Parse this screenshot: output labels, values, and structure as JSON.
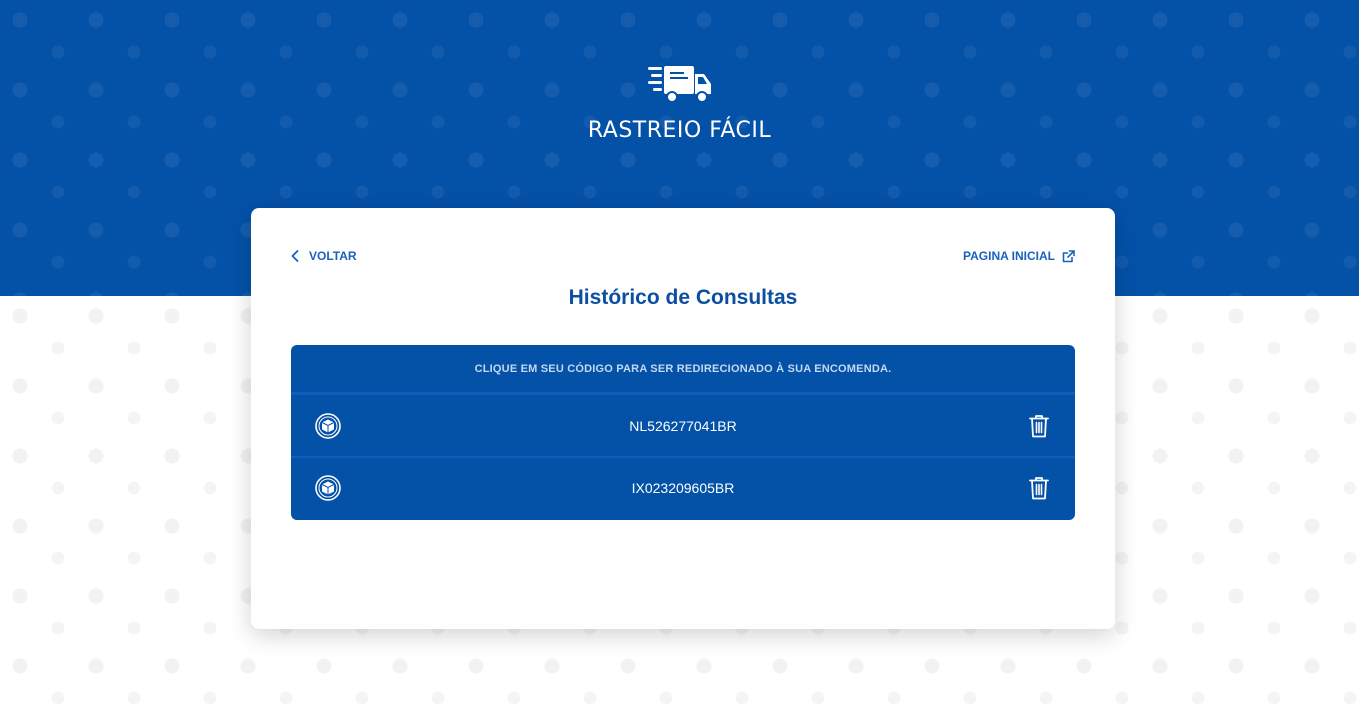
{
  "brand": {
    "name": "RASTREIO FÁCIL",
    "logo_icon": "delivery-truck-icon"
  },
  "nav": {
    "back_label": "VOLTAR",
    "home_label": "PAGINA INICIAL"
  },
  "page": {
    "title": "Histórico de Consultas"
  },
  "history": {
    "instruction": "CLIQUE EM SEU CÓDIGO PARA SER REDIRECIONADO À SUA ENCOMENDA.",
    "items": [
      {
        "code": "NL526277041BR",
        "icon": "package-icon",
        "action_icon": "trash-icon"
      },
      {
        "code": "IX023209605BR",
        "icon": "package-icon",
        "action_icon": "trash-icon"
      }
    ]
  },
  "colors": {
    "primary": "#0451a8",
    "link": "#1a61bd",
    "title": "#0b4fa3",
    "background": "#ffffff"
  }
}
